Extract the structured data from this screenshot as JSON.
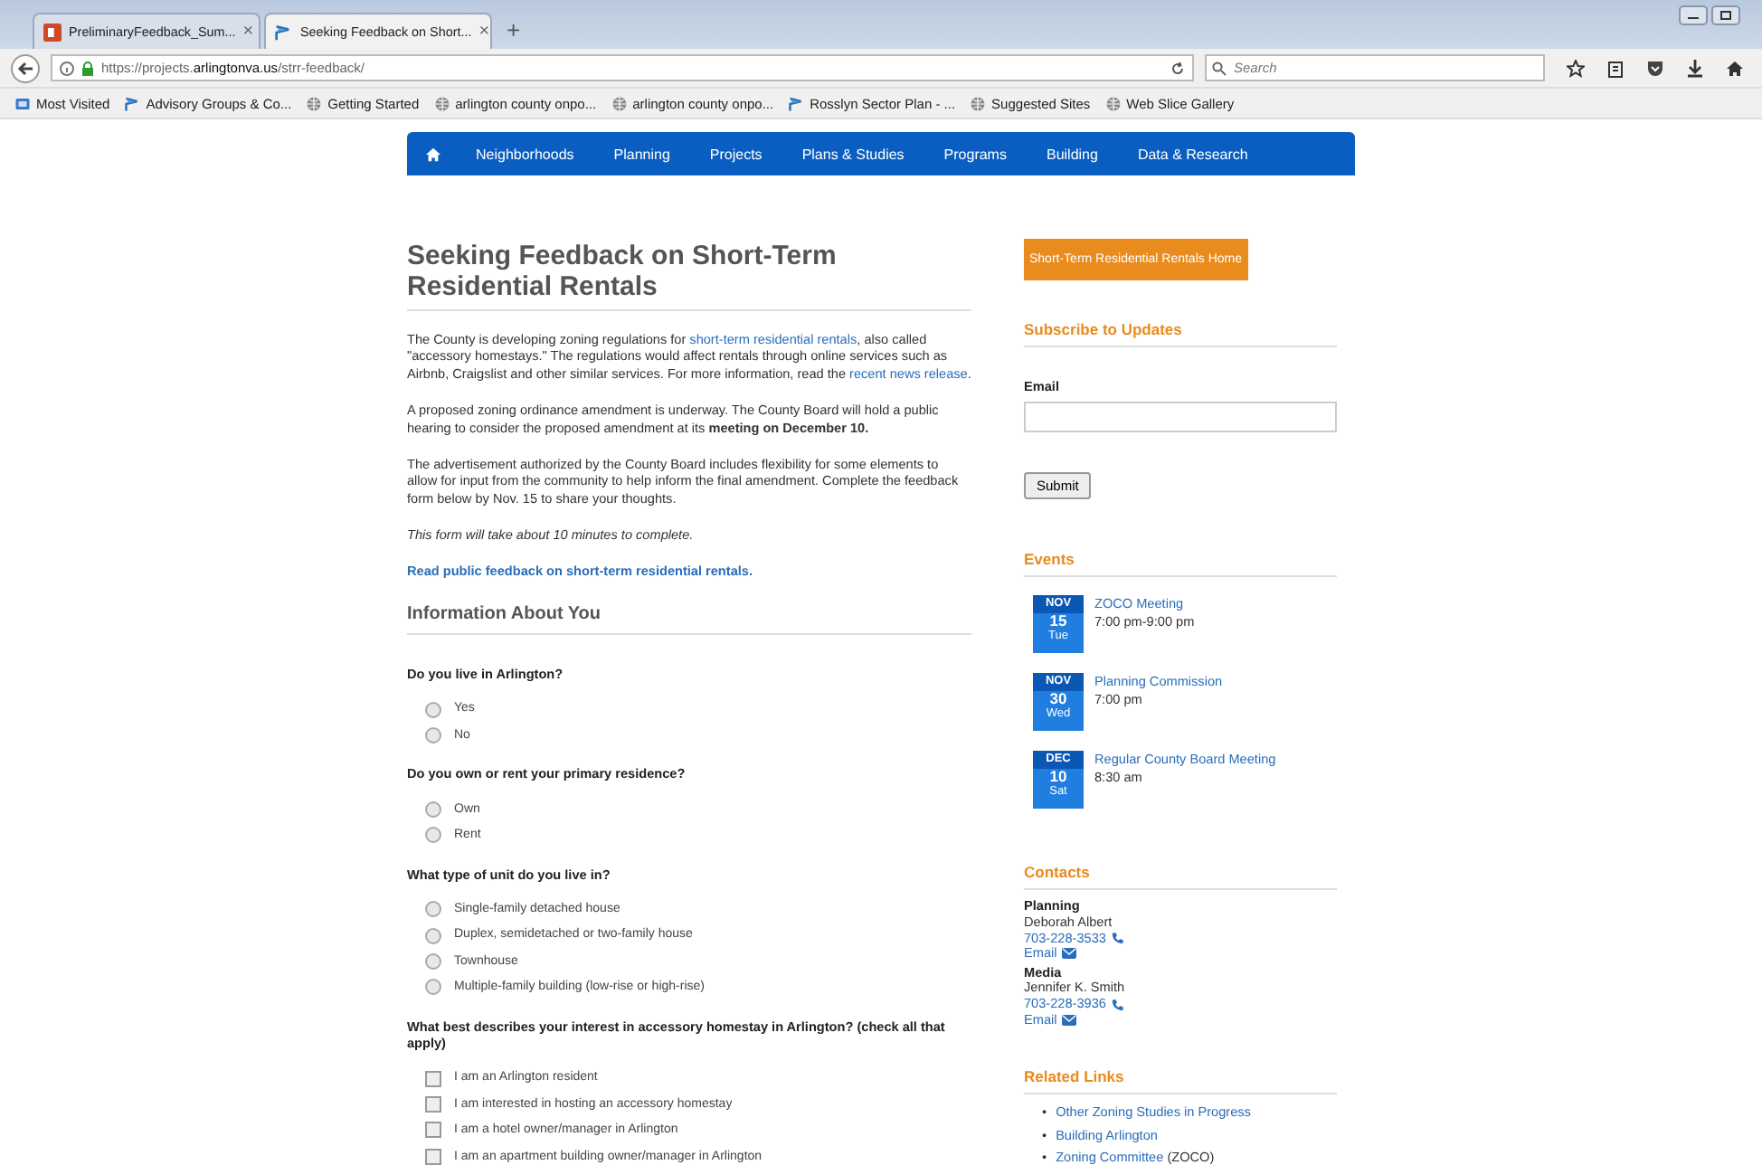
{
  "browser": {
    "tabs": [
      {
        "title": "PreliminaryFeedback_Sum...",
        "close": "×",
        "selected": false
      },
      {
        "title": "Seeking Feedback on Short...",
        "close": "×",
        "selected": true
      }
    ],
    "new_tab": "+",
    "url": "https://projects.**arlingtonva.us**/strr-feedback/",
    "search": {
      "placeholder": "Search"
    },
    "bookmarks": [
      {
        "label": "Most Visited"
      },
      {
        "label": "Advisory Groups & Co..."
      },
      {
        "label": "Getting Started"
      },
      {
        "label": "arlington county onpo..."
      },
      {
        "label": "arlington county onpo..."
      },
      {
        "label": "Rosslyn Sector Plan - ..."
      },
      {
        "label": "Suggested Sites"
      },
      {
        "label": "Web Slice Gallery"
      }
    ]
  },
  "nav": {
    "items": [
      "Neighborhoods",
      "Planning",
      "Projects",
      "Plans & Studies",
      "Programs",
      "Building",
      "Data & Research"
    ]
  },
  "main": {
    "title": "Seeking Feedback on Short-Term Residential Rentals",
    "paragraphs": [
      [
        {
          "kind": "text",
          "text": "The County is developing zoning regulations for "
        },
        {
          "kind": "link",
          "text": "short-term residential rentals"
        },
        {
          "kind": "text",
          "text": ", also called \"accessory homestays.\" The regulations would affect rentals through online services such as Airbnb, Craigslist and other similar services. For more information, read the "
        },
        {
          "kind": "link",
          "text": "recent news release"
        },
        {
          "kind": "text",
          "text": "."
        }
      ],
      [
        {
          "kind": "text",
          "text": "A proposed zoning ordinance amendment is underway. The County Board will hold a public hearing to consider the proposed amendment at its "
        },
        {
          "kind": "bold",
          "text": "meeting on December 10."
        }
      ],
      [
        {
          "kind": "text",
          "text": "The advertisement authorized by the County Board includes flexibility for some elements to allow for input from the community to help inform the final amendment. Complete the feedback form below by Nov. 15 to share your thoughts."
        }
      ]
    ],
    "note": "This form will take about 10 minutes to complete.",
    "feedback_link": "Read public feedback on short-term residential rentals.",
    "section": "Information About You",
    "questions": [
      {
        "label": "Do you live in Arlington?",
        "kind": "radio",
        "options": [
          {
            "label": "Yes",
            "checked": false
          },
          {
            "label": "No",
            "checked": false
          }
        ]
      },
      {
        "label": "Do you own or rent your primary residence?",
        "kind": "radio",
        "options": [
          {
            "label": "Own",
            "checked": false
          },
          {
            "label": "Rent",
            "checked": false
          }
        ]
      },
      {
        "label": "What type of unit do you live in?",
        "kind": "radio",
        "options": [
          {
            "label": "Single-family detached house",
            "checked": false
          },
          {
            "label": "Duplex, semidetached or two-family house",
            "checked": false
          },
          {
            "label": "Townhouse",
            "checked": false
          },
          {
            "label": "Multiple-family building (low-rise or high-rise)",
            "checked": false
          }
        ]
      },
      {
        "label": "What best describes your interest in accessory homestay in Arlington? (check all that apply)",
        "kind": "checkbox",
        "options": [
          {
            "label": "I am an Arlington resident",
            "checked": false
          },
          {
            "label": "I am interested in hosting an accessory homestay",
            "checked": false
          },
          {
            "label": "I am a hotel owner/manager in Arlington",
            "checked": false
          },
          {
            "label": "I am an apartment building owner/manager in Arlington",
            "checked": false
          }
        ]
      }
    ]
  },
  "sidebar": {
    "home_button": "Short-Term Residential Rentals Home",
    "subscribe": {
      "heading": "Subscribe to Updates",
      "label": "Email",
      "button": "Submit"
    },
    "events": {
      "heading": "Events",
      "items": [
        {
          "month": "NOV",
          "day": "15",
          "weekday": "Tue",
          "title": "ZOCO Meeting",
          "time": "7:00 pm-9:00 pm"
        },
        {
          "month": "NOV",
          "day": "30",
          "weekday": "Wed",
          "title": "Planning Commission",
          "time": "7:00 pm"
        },
        {
          "month": "DEC",
          "day": "10",
          "weekday": "Sat",
          "title": "Regular County Board Meeting",
          "time": "8:30 am"
        }
      ]
    },
    "contacts": {
      "heading": "Contacts",
      "items": [
        {
          "group": "Planning",
          "name": "Deborah Albert",
          "phone": "703-228-3533",
          "email": "Email"
        },
        {
          "group": "Media",
          "name": "Jennifer K. Smith",
          "phone": "703-228-3936",
          "email": "Email"
        }
      ]
    },
    "related": {
      "heading": "Related Links",
      "items": [
        {
          "marker": "•",
          "link": "Other Zoning Studies in Progress"
        },
        {
          "marker": "•",
          "link": "Building Arlington"
        },
        {
          "marker": "•",
          "link": "Zoning Committee",
          "suffix": "(ZOCO)"
        }
      ]
    }
  }
}
